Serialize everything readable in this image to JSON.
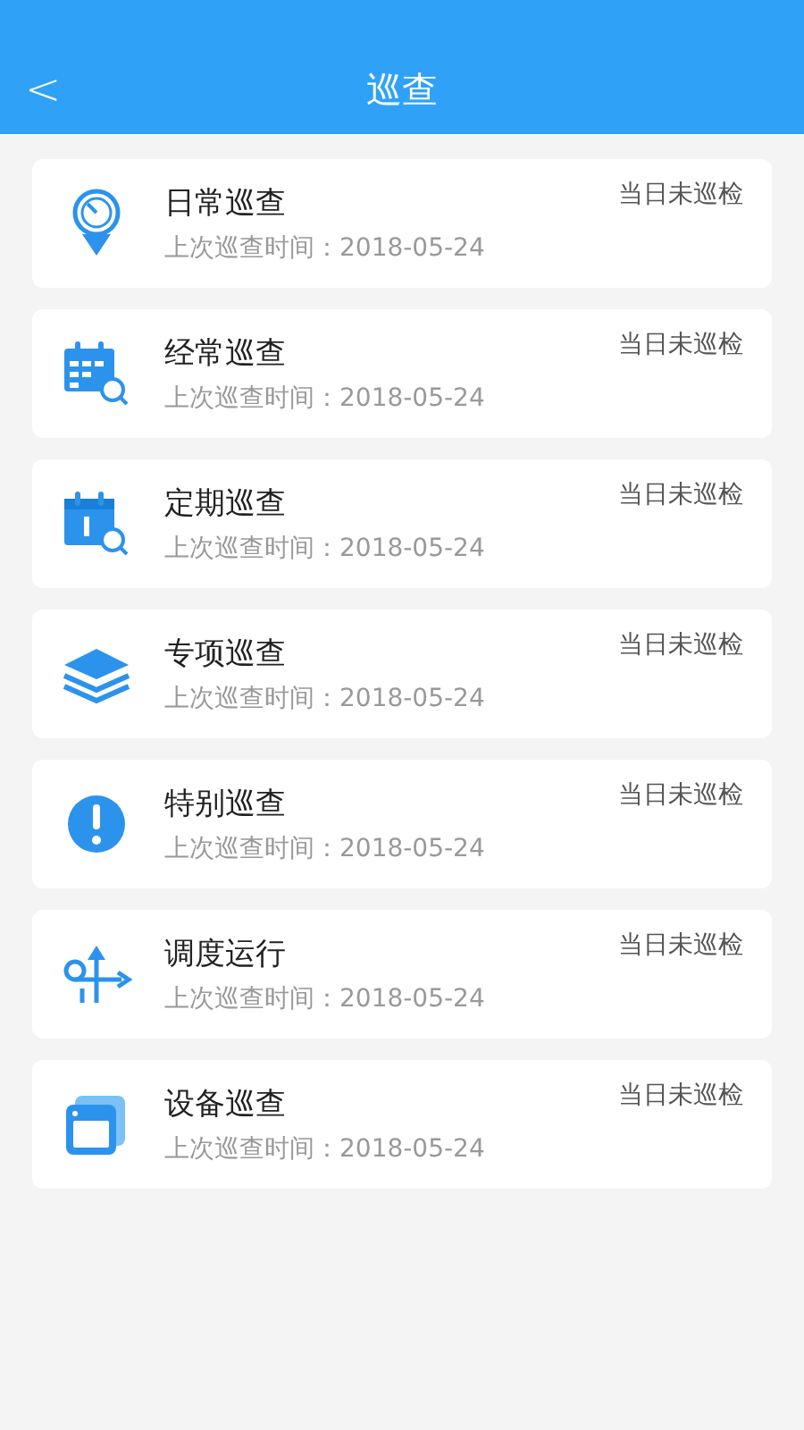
{
  "header": {
    "back_glyph": "<",
    "title": "巡查"
  },
  "items": [
    {
      "title": "日常巡查",
      "status": "当日未巡检",
      "last_check": "上次巡查时间：2018-05-24"
    },
    {
      "title": "经常巡查",
      "status": "当日未巡检",
      "last_check": "上次巡查时间：2018-05-24"
    },
    {
      "title": "定期巡查",
      "status": "当日未巡检",
      "last_check": "上次巡查时间：2018-05-24"
    },
    {
      "title": "专项巡查",
      "status": "当日未巡检",
      "last_check": "上次巡查时间：2018-05-24"
    },
    {
      "title": "特别巡查",
      "status": "当日未巡检",
      "last_check": "上次巡查时间：2018-05-24"
    },
    {
      "title": "调度运行",
      "status": "当日未巡检",
      "last_check": "上次巡查时间：2018-05-24"
    },
    {
      "title": "设备巡查",
      "status": "当日未巡检",
      "last_check": "上次巡查时间：2018-05-24"
    }
  ]
}
